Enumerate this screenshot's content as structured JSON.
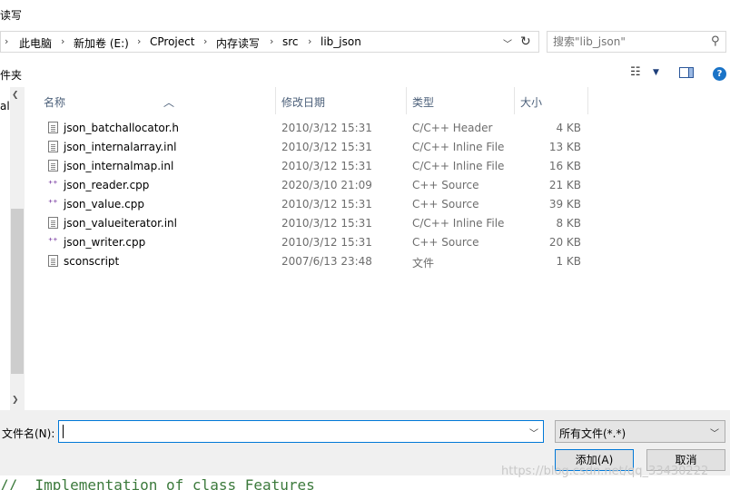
{
  "window": {
    "title": "读写"
  },
  "address": {
    "crumbs": [
      "此电脑",
      "新加卷 (E:)",
      "CProject",
      "内存读写",
      "src",
      "lib_json"
    ],
    "separator": "›"
  },
  "search": {
    "placeholder": "搜索\"lib_json\""
  },
  "toolbar": {
    "new_folder_label": "件夹"
  },
  "navpane": {
    "visible_text": "al"
  },
  "columns": {
    "name": "名称",
    "date": "修改日期",
    "type": "类型",
    "size": "大小"
  },
  "files": [
    {
      "name": "json_batchallocator.h",
      "date": "2010/3/12 15:31",
      "type": "C/C++ Header",
      "size": "4 KB",
      "icon": "header-file-icon"
    },
    {
      "name": "json_internalarray.inl",
      "date": "2010/3/12 15:31",
      "type": "C/C++ Inline File",
      "size": "13 KB",
      "icon": "document-file-icon"
    },
    {
      "name": "json_internalmap.inl",
      "date": "2010/3/12 15:31",
      "type": "C/C++ Inline File",
      "size": "16 KB",
      "icon": "document-file-icon"
    },
    {
      "name": "json_reader.cpp",
      "date": "2020/3/10 21:09",
      "type": "C++ Source",
      "size": "21 KB",
      "icon": "cpp-file-icon"
    },
    {
      "name": "json_value.cpp",
      "date": "2010/3/12 15:31",
      "type": "C++ Source",
      "size": "39 KB",
      "icon": "cpp-file-icon"
    },
    {
      "name": "json_valueiterator.inl",
      "date": "2010/3/12 15:31",
      "type": "C/C++ Inline File",
      "size": "8 KB",
      "icon": "document-file-icon"
    },
    {
      "name": "json_writer.cpp",
      "date": "2010/3/12 15:31",
      "type": "C++ Source",
      "size": "20 KB",
      "icon": "cpp-file-icon"
    },
    {
      "name": "sconscript",
      "date": "2007/6/13 23:48",
      "type": "文件",
      "size": "1 KB",
      "icon": "blank-file-icon"
    }
  ],
  "bottom": {
    "filename_label": "文件名(N):",
    "filename_value": "",
    "filter_value": "所有文件(*.*)",
    "add_button": "添加(A)",
    "cancel_button": "取消"
  },
  "background": {
    "code_line": "//  Implementation of class Features",
    "watermark": "https://blog.csdn.net/qq_33430222"
  },
  "colors": {
    "accent": "#0078d7",
    "cpp_icon": "#7b3fa3",
    "header_text": "#4c607a"
  }
}
